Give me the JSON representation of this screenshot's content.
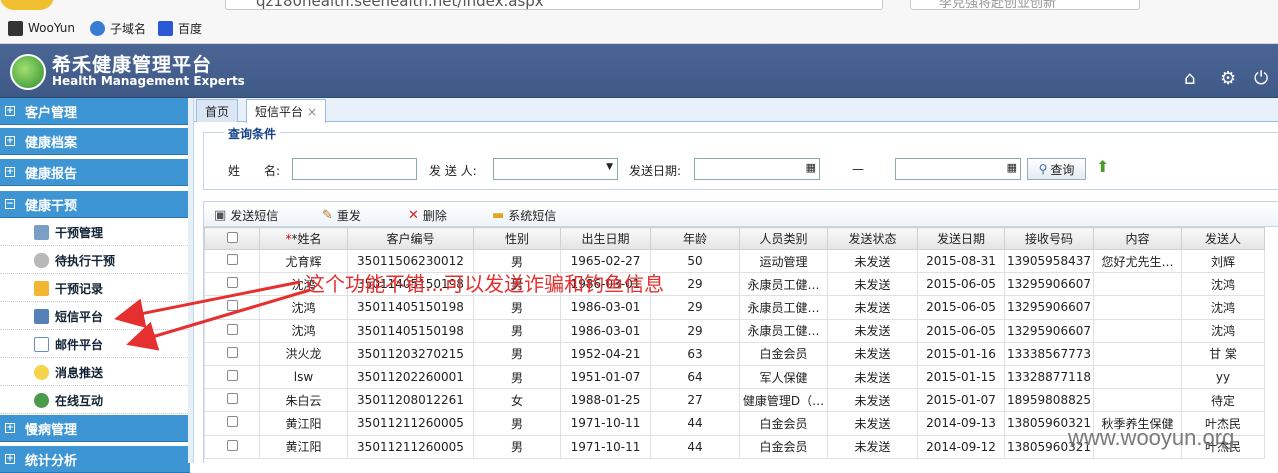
{
  "browser": {
    "url": "qz180health.seehealth.net/index.aspx",
    "search_placeholder": "李克强将赴创业创新",
    "bookmarks": [
      {
        "label": "WooYun"
      },
      {
        "label": "子域名"
      },
      {
        "label": "百度"
      }
    ]
  },
  "app": {
    "title": "希禾健康管理平台",
    "subtitle": "Health Management Experts"
  },
  "sidebar": {
    "groups": [
      {
        "label": "客户管理",
        "expanded": false
      },
      {
        "label": "健康档案",
        "expanded": false
      },
      {
        "label": "健康报告",
        "expanded": false
      },
      {
        "label": "健康干预",
        "expanded": true
      },
      {
        "label": "慢病管理",
        "expanded": false
      },
      {
        "label": "统计分析",
        "expanded": false
      }
    ],
    "items": [
      {
        "label": "干预管理",
        "icon": "doc-icon"
      },
      {
        "label": "待执行干预",
        "icon": "pill-icon"
      },
      {
        "label": "干预记录",
        "icon": "record-icon"
      },
      {
        "label": "短信平台",
        "icon": "sms-icon"
      },
      {
        "label": "邮件平台",
        "icon": "mail-icon"
      },
      {
        "label": "消息推送",
        "icon": "bulb-icon"
      },
      {
        "label": "在线互动",
        "icon": "people-icon"
      }
    ]
  },
  "tabs": [
    {
      "label": "首页"
    },
    {
      "label": "短信平台"
    }
  ],
  "query": {
    "legend": "查询条件",
    "name_label": "姓　　名:",
    "sender_label": "发 送 人:",
    "date_label": "发送日期:",
    "range_sep": "—",
    "search_button": "查询"
  },
  "toolbar": {
    "send": "发送短信",
    "resend": "重发",
    "delete": "删除",
    "system": "系统短信"
  },
  "table": {
    "columns": [
      "*姓名",
      "客户编号",
      "性别",
      "出生日期",
      "年龄",
      "人员类别",
      "发送状态",
      "发送日期",
      "接收号码",
      "内容",
      "发送人"
    ],
    "rows": [
      [
        "尤育辉",
        "35011506230012",
        "男",
        "1965-02-27",
        "50",
        "运动管理",
        "未发送",
        "2015-08-31",
        "13905958437",
        "您好尤先生…",
        "刘辉"
      ],
      [
        "沈鸿",
        "35011405150198",
        "男",
        "1986-03-01",
        "29",
        "永康员工健…",
        "未发送",
        "2015-06-05",
        "13295906607",
        "",
        "沈鸿"
      ],
      [
        "沈鸿",
        "35011405150198",
        "男",
        "1986-03-01",
        "29",
        "永康员工健…",
        "未发送",
        "2015-06-05",
        "13295906607",
        "",
        "沈鸿"
      ],
      [
        "沈鸿",
        "35011405150198",
        "男",
        "1986-03-01",
        "29",
        "永康员工健…",
        "未发送",
        "2015-06-05",
        "13295906607",
        "",
        "沈鸿"
      ],
      [
        "洪火龙",
        "35011203270215",
        "男",
        "1952-04-21",
        "63",
        "白金会员",
        "未发送",
        "2015-01-16",
        "13338567773",
        "",
        "甘 棠"
      ],
      [
        "lsw",
        "35011202260001",
        "男",
        "1951-01-07",
        "64",
        "军人保健",
        "未发送",
        "2015-01-15",
        "13328877118",
        "",
        "yy"
      ],
      [
        "朱白云",
        "35011208012261",
        "女",
        "1988-01-25",
        "27",
        "健康管理D（…",
        "未发送",
        "2015-01-07",
        "18959808825",
        "",
        "待定"
      ],
      [
        "黄江阳",
        "35011211260005",
        "男",
        "1971-10-11",
        "44",
        "白金会员",
        "未发送",
        "2014-09-13",
        "13805960321",
        "秋季养生保健",
        "叶杰民"
      ],
      [
        "黄江阳",
        "35011211260005",
        "男",
        "1971-10-11",
        "44",
        "白金会员",
        "未发送",
        "2014-09-12",
        "13805960321",
        "",
        "叶杰民"
      ]
    ]
  },
  "annotation": "这个功能不错...可以发送诈骗和钓鱼信息",
  "watermark": "www.wooyun.org",
  "colors": {
    "header": "#4a6594",
    "sidebar_group": "#3e95d4",
    "annotation": "#e63030"
  }
}
